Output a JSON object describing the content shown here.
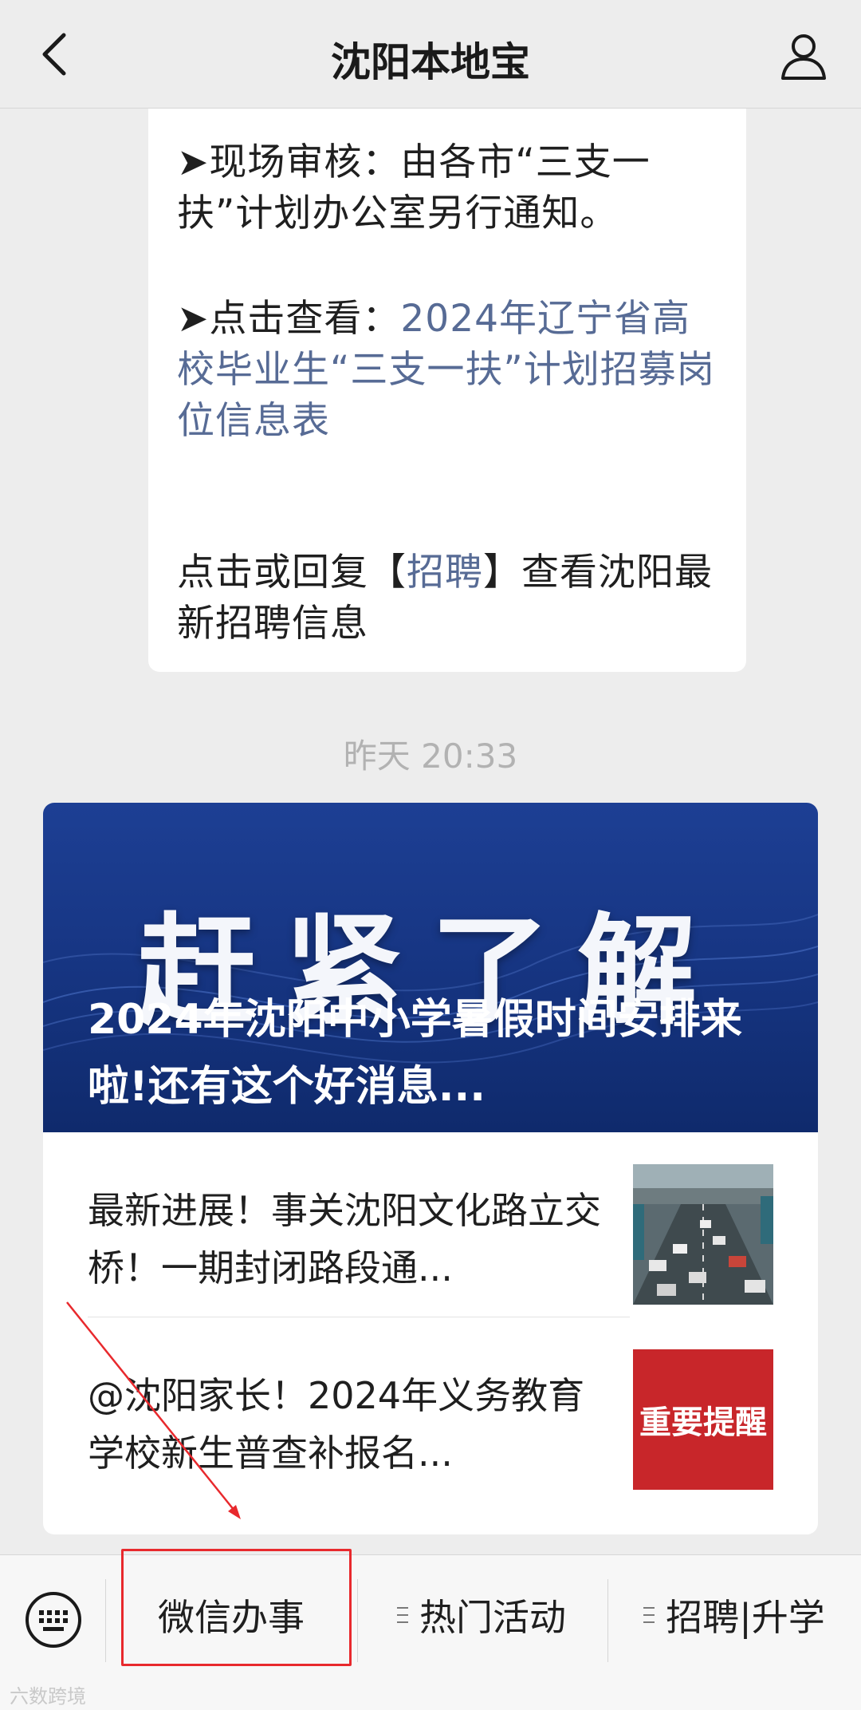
{
  "header": {
    "title": "沈阳本地宝",
    "back_icon": "chevron-left-icon",
    "profile_icon": "person-icon"
  },
  "message": {
    "p1": "➤现场审核：由各市“三支一扶”计划办公室另行通知。",
    "p2_prefix": "➤点击查看：",
    "p2_link": "2024年辽宁省高校毕业生“三支一扶”计划招募岗位信息表",
    "p3_before": "点击或回复【",
    "p3_link": "招聘",
    "p3_after": "】查看沈阳最新招聘信息"
  },
  "timestamp": "昨天 20:33",
  "articles": {
    "cover_big_text": "赶紧了解",
    "cover_headline": "2024年沈阳中小学暑假时间安排来啦!还有这个好消息...",
    "items": [
      {
        "title": "最新进展！事关沈阳文化路立交桥！一期封闭路段通...",
        "thumb": "traffic-road-thumbnail"
      },
      {
        "title": "@沈阳家长！2024年义务教育学校新生普查补报名...",
        "thumb_text": "重要提醒"
      }
    ]
  },
  "menu": {
    "keyboard_icon": "keyboard-icon",
    "items": [
      "微信办事",
      "热门活动",
      "招聘|升学"
    ]
  },
  "colors": {
    "link": "#576b95",
    "annotation": "#e8292d",
    "background": "#ededed"
  },
  "watermark": "六数跨境"
}
